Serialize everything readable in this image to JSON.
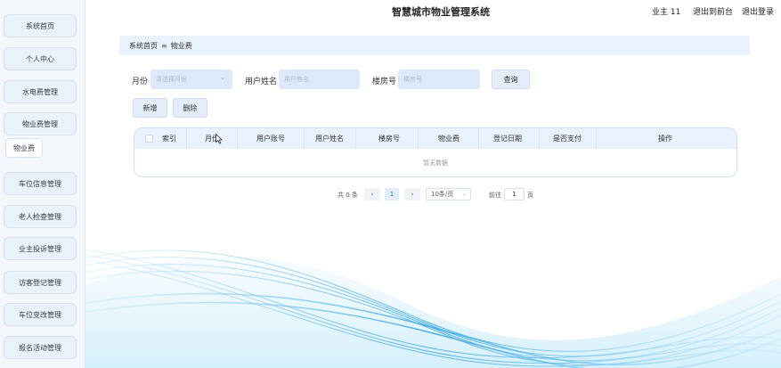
{
  "header": {
    "title": "智慧城市物业管理系统",
    "user": "业主 11",
    "back_to_front": "退出到前台",
    "logout": "退出登录"
  },
  "sidebar": {
    "items": [
      {
        "label": "系统首页"
      },
      {
        "label": "个人中心"
      },
      {
        "label": "水电费管理"
      },
      {
        "label": "物业费管理"
      },
      {
        "label": "车位信息管理"
      },
      {
        "label": "老人检查管理"
      },
      {
        "label": "业主投诉管理"
      },
      {
        "label": "访客登记管理"
      },
      {
        "label": "车位变改管理"
      },
      {
        "label": "报名活动管理"
      }
    ],
    "sub_item": "物业费"
  },
  "breadcrumb": {
    "home": "系统首页",
    "separator": "≡",
    "current": "物业费"
  },
  "search": {
    "month_label": "月份",
    "month_placeholder": "请选择月份",
    "username_label": "用户姓名",
    "username_placeholder": "用户姓名",
    "room_label": "楼房号",
    "room_placeholder": "楼房号",
    "query_button": "查询"
  },
  "actions": {
    "add": "新增",
    "delete": "删除"
  },
  "table": {
    "columns": [
      "索引",
      "月份",
      "用户账号",
      "用户姓名",
      "楼房号",
      "物业费",
      "登记日期",
      "是否支付",
      "操作"
    ],
    "empty_text": "暂无数据"
  },
  "pagination": {
    "total": "共 0 条",
    "prev": "‹",
    "current_page": "1",
    "next": "›",
    "page_size": "10条/页",
    "goto_label": "前往",
    "goto_value": "1",
    "page_unit": "页"
  },
  "colors": {
    "sidebar_bg": "#f4f8fd",
    "button_bg": "#e3eefa",
    "header_row_bg": "#e8f2fc",
    "accent": "#1f6fc8",
    "wave": "#3aa8e8"
  },
  "icons": {
    "chevron": "chevron-down-icon",
    "cursor": "mouse-cursor-icon"
  }
}
